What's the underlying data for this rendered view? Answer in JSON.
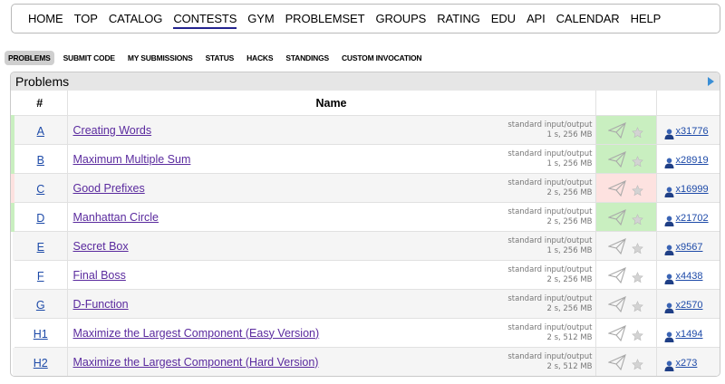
{
  "top_menu": [
    "HOME",
    "TOP",
    "CATALOG",
    "CONTESTS",
    "GYM",
    "PROBLEMSET",
    "GROUPS",
    "RATING",
    "EDU",
    "API",
    "CALENDAR",
    "HELP"
  ],
  "top_menu_active": "CONTESTS",
  "tabs": [
    "PROBLEMS",
    "SUBMIT CODE",
    "MY SUBMISSIONS",
    "STATUS",
    "HACKS",
    "STANDINGS",
    "CUSTOM INVOCATION"
  ],
  "tabs_active": "PROBLEMS",
  "panel": {
    "title": "Problems",
    "col_index": "#",
    "col_name": "Name"
  },
  "problems": [
    {
      "index": "A",
      "name": "Creating Words",
      "io": "standard input/output",
      "limits": "1 s, 256 MB",
      "solved": "x31776",
      "status": "ok"
    },
    {
      "index": "B",
      "name": "Maximum Multiple Sum",
      "io": "standard input/output",
      "limits": "1 s, 256 MB",
      "solved": "x28919",
      "status": "ok"
    },
    {
      "index": "C",
      "name": "Good Prefixes",
      "io": "standard input/output",
      "limits": "2 s, 256 MB",
      "solved": "x16999",
      "status": "fail"
    },
    {
      "index": "D",
      "name": "Manhattan Circle",
      "io": "standard input/output",
      "limits": "2 s, 256 MB",
      "solved": "x21702",
      "status": "ok"
    },
    {
      "index": "E",
      "name": "Secret Box",
      "io": "standard input/output",
      "limits": "1 s, 256 MB",
      "solved": "x9567",
      "status": "none"
    },
    {
      "index": "F",
      "name": "Final Boss",
      "io": "standard input/output",
      "limits": "2 s, 256 MB",
      "solved": "x4438",
      "status": "none"
    },
    {
      "index": "G",
      "name": "D-Function",
      "io": "standard input/output",
      "limits": "2 s, 256 MB",
      "solved": "x2570",
      "status": "none"
    },
    {
      "index": "H1",
      "name": "Maximize the Largest Component (Easy Version)",
      "io": "standard input/output",
      "limits": "2 s, 512 MB",
      "solved": "x1494",
      "status": "none"
    },
    {
      "index": "H2",
      "name": "Maximize the Largest Component (Hard Version)",
      "io": "standard input/output",
      "limits": "2 s, 512 MB",
      "solved": "x273",
      "status": "none"
    }
  ],
  "colors": {
    "ok": "#c9efc0",
    "fail": "#fde2e0",
    "link": "#1d4aa8",
    "visited": "#5a2a9e"
  },
  "icons": {
    "submit": "paper-plane-icon",
    "favourite": "star-icon",
    "solvers": "user-icon"
  }
}
